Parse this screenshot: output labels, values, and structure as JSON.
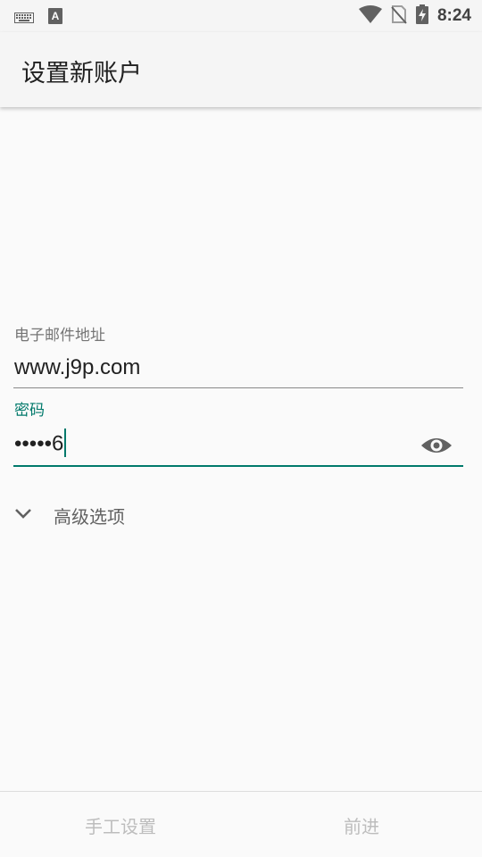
{
  "status_bar": {
    "time": "8:24",
    "icons": [
      "keyboard-icon",
      "a-notification-icon",
      "wifi-icon",
      "no-sim-icon",
      "battery-charging-icon"
    ]
  },
  "app_bar": {
    "title": "设置新账户"
  },
  "form": {
    "email_label": "电子邮件地址",
    "email_value": "www.j9p.com",
    "password_label": "密码",
    "password_value": "•••••6",
    "password_toggle_icon": "eye-icon",
    "advanced_label": "高级选项",
    "advanced_icon": "chevron-down-icon"
  },
  "bottom_bar": {
    "manual_setup_label": "手工设置",
    "next_label": "前进"
  },
  "colors": {
    "accent": "#00796b",
    "disabled_text": "#bdbdbd"
  }
}
